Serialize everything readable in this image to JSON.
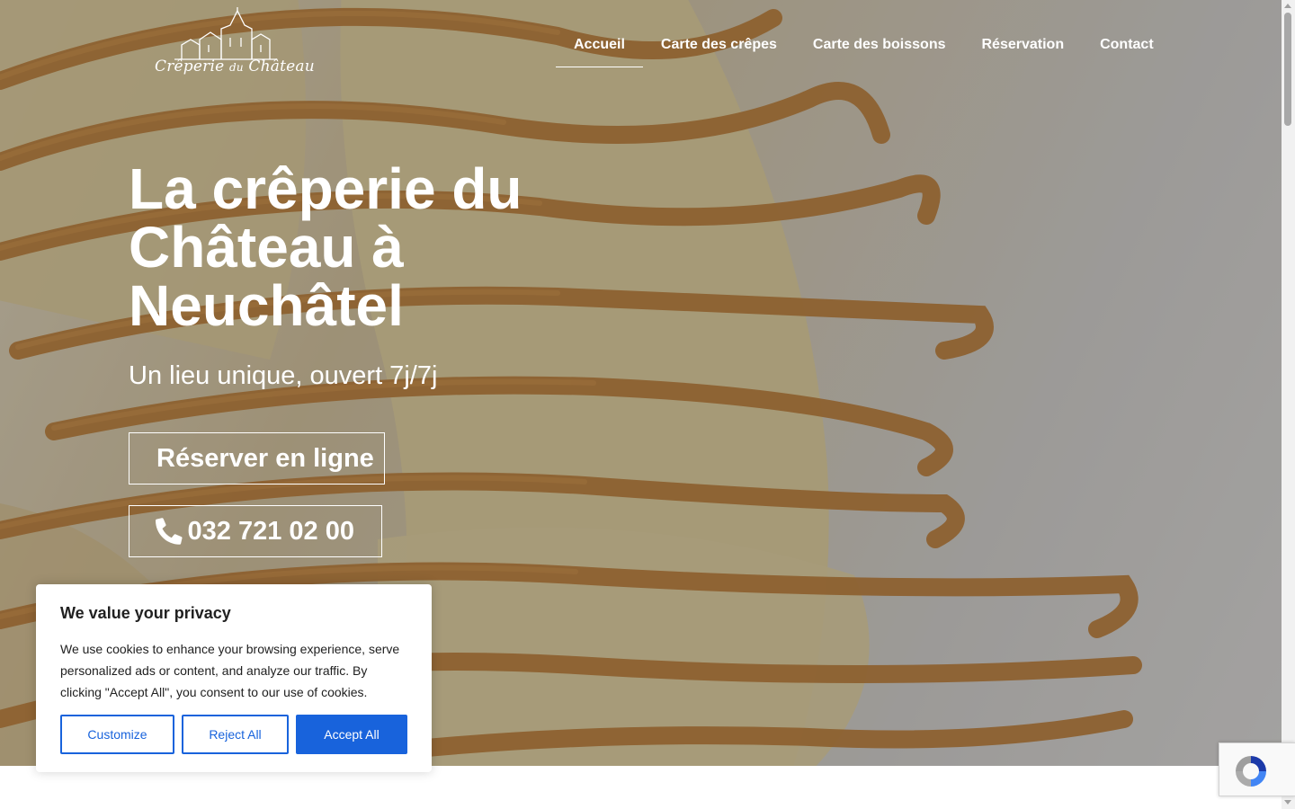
{
  "brand": {
    "logo_text_main": "Crêperie",
    "logo_text_small": "du",
    "logo_text_end": "Château"
  },
  "nav": {
    "items": [
      {
        "label": "Accueil",
        "active": true
      },
      {
        "label": "Carte des crêpes",
        "active": false
      },
      {
        "label": "Carte des boissons",
        "active": false
      },
      {
        "label": "Réservation",
        "active": false
      },
      {
        "label": "Contact",
        "active": false
      }
    ]
  },
  "hero": {
    "title": "La crêperie du Château à Neuchâtel",
    "subtitle": "Un lieu unique, ouvert 7j/7j",
    "reserve_label": "Réserver en ligne",
    "phone_label": "032 721 02 00",
    "phone_icon": "phone-icon"
  },
  "cookie_banner": {
    "title": "We value your privacy",
    "text": "We use cookies to enhance your browsing experience, serve personalized ads or content, and analyze our traffic. By clicking \"Accept All\", you consent to our use of cookies.",
    "customize_label": "Customize",
    "reject_label": "Reject All",
    "accept_label": "Accept All"
  },
  "colors": {
    "accent": "#1863dc",
    "caramel": "#c0782a",
    "text_dark": "#212121"
  }
}
